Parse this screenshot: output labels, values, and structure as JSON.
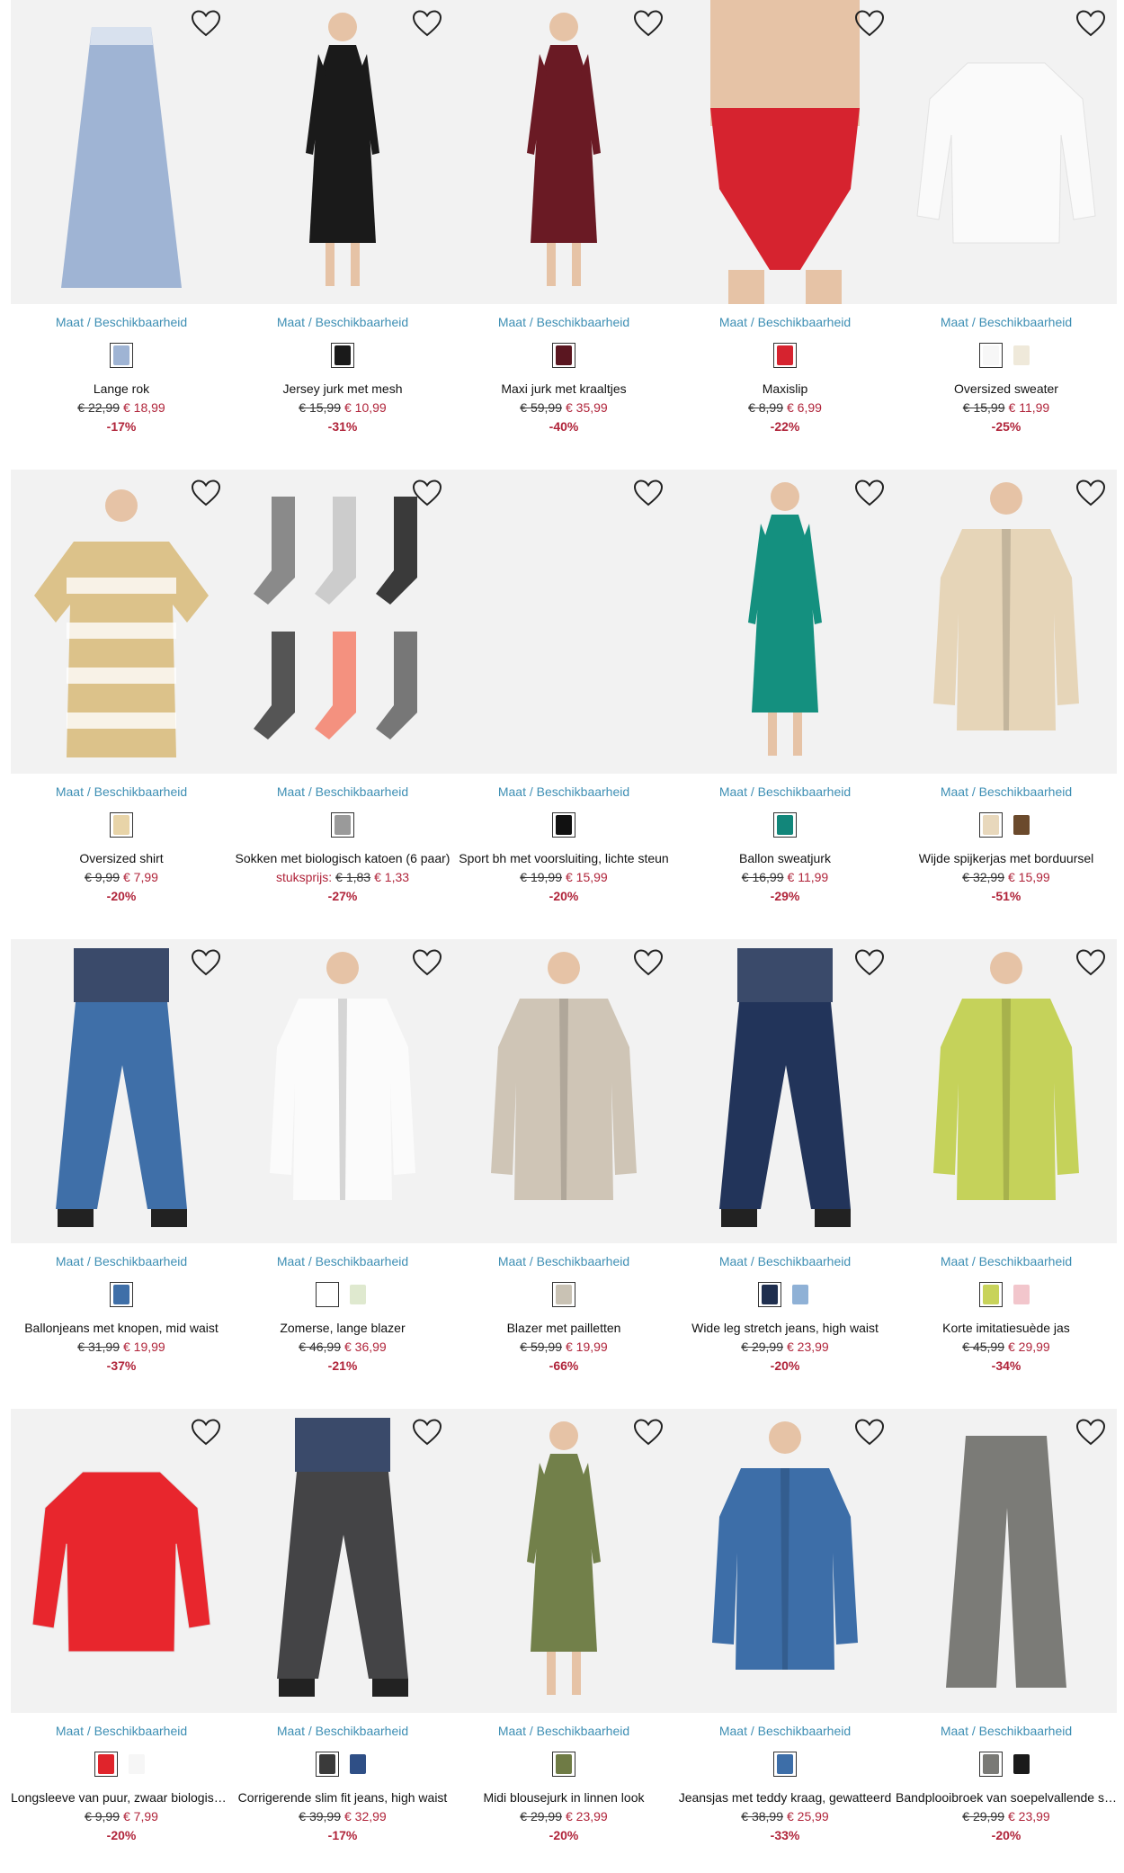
{
  "colors": {
    "link": "#3e8fb4",
    "sale": "#b0243a",
    "image_bg": "#f2f2f2"
  },
  "products": [
    {
      "name": "Lange rok",
      "old": "€ 22,99",
      "new": "€ 18,99",
      "disc": "-17%",
      "maat": "Maat / Beschikbaarheid",
      "swatches": [
        "#9fb4d4"
      ],
      "garment": "skirt",
      "color": "#9fb4d4",
      "heart_icon": "heart-outline-icon"
    },
    {
      "name": "Jersey jurk met mesh",
      "old": "€ 15,99",
      "new": "€ 10,99",
      "disc": "-31%",
      "maat": "Maat / Beschikbaarheid",
      "swatches": [
        "#1a1a1a"
      ],
      "garment": "dress",
      "color": "#1a1a1a",
      "heart_icon": "heart-outline-icon"
    },
    {
      "name": "Maxi jurk met kraaltjes",
      "old": "€ 59,99",
      "new": "€ 35,99",
      "disc": "-40%",
      "maat": "Maat / Beschikbaarheid",
      "swatches": [
        "#5a1620"
      ],
      "garment": "dress",
      "color": "#6a1a24",
      "heart_icon": "heart-outline-icon"
    },
    {
      "name": "Maxislip",
      "old": "€ 8,99",
      "new": "€ 6,99",
      "disc": "-22%",
      "maat": "Maat / Beschikbaarheid",
      "swatches": [
        "#d6232f"
      ],
      "garment": "brief",
      "color": "#d6232f",
      "heart_icon": "heart-outline-icon"
    },
    {
      "name": "Oversized sweater",
      "old": "€ 15,99",
      "new": "€ 11,99",
      "disc": "-25%",
      "maat": "Maat / Beschikbaarheid",
      "swatches": [
        "#f7f7f7",
        "#efe9da"
      ],
      "garment": "top",
      "color": "#fafafa",
      "heart_icon": "heart-outline-icon"
    },
    {
      "name": "Oversized shirt",
      "old": "€ 9,99",
      "new": "€ 7,99",
      "disc": "-20%",
      "maat": "Maat / Beschikbaarheid",
      "swatches": [
        "#e8d4a8"
      ],
      "garment": "tee",
      "color": "#dcc28a",
      "heart_icon": "heart-outline-icon"
    },
    {
      "name": "Sokken met biologisch katoen (6 paar)",
      "unit": "stuksprijs:",
      "old": "€ 1,83",
      "new": "€ 1,33",
      "disc": "-27%",
      "maat": "Maat / Beschikbaarheid",
      "swatches": [
        "#9a9a9a"
      ],
      "garment": "socks",
      "color": "#888888",
      "heart_icon": "heart-outline-icon"
    },
    {
      "name": "Sport bh met voorsluiting, lichte steun",
      "old": "€ 19,99",
      "new": "€ 15,99",
      "disc": "-20%",
      "maat": "Maat / Beschikbaarheid",
      "swatches": [
        "#111111"
      ],
      "garment": "none",
      "color": "#f2f2f2",
      "heart_icon": "heart-outline-icon"
    },
    {
      "name": "Ballon sweatjurk",
      "old": "€ 16,99",
      "new": "€ 11,99",
      "disc": "-29%",
      "maat": "Maat / Beschikbaarheid",
      "swatches": [
        "#12867a"
      ],
      "garment": "dress",
      "color": "#14907f",
      "heart_icon": "heart-outline-icon"
    },
    {
      "name": "Wijde spijkerjas met borduursel",
      "old": "€ 32,99",
      "new": "€ 15,99",
      "disc": "-51%",
      "maat": "Maat / Beschikbaarheid",
      "swatches": [
        "#e8d8bc",
        "#6b4a2c"
      ],
      "garment": "jacket",
      "color": "#e6d5b8",
      "heart_icon": "heart-outline-icon"
    },
    {
      "name": "Ballonjeans met knopen, mid waist",
      "old": "€ 31,99",
      "new": "€ 19,99",
      "disc": "-37%",
      "maat": "Maat / Beschikbaarheid",
      "swatches": [
        "#3f6fa8"
      ],
      "garment": "jeans",
      "color": "#3f6fa8",
      "heart_icon": "heart-outline-icon"
    },
    {
      "name": "Zomerse, lange blazer",
      "old": "€ 46,99",
      "new": "€ 36,99",
      "disc": "-21%",
      "maat": "Maat / Beschikbaarheid",
      "swatches": [
        "#ffffff",
        "#dfe9cf"
      ],
      "garment": "jacket",
      "color": "#fbfbfb",
      "heart_icon": "heart-outline-icon"
    },
    {
      "name": "Blazer met pailletten",
      "old": "€ 59,99",
      "new": "€ 19,99",
      "disc": "-66%",
      "maat": "Maat / Beschikbaarheid",
      "swatches": [
        "#c9c2b4"
      ],
      "garment": "jacket",
      "color": "#cfc5b6",
      "heart_icon": "heart-outline-icon"
    },
    {
      "name": "Wide leg stretch jeans, high waist",
      "old": "€ 29,99",
      "new": "€ 23,99",
      "disc": "-20%",
      "maat": "Maat / Beschikbaarheid",
      "swatches": [
        "#1f2f4f",
        "#8fb1d6"
      ],
      "garment": "jeans",
      "color": "#22345a",
      "heart_icon": "heart-outline-icon"
    },
    {
      "name": "Korte imitatiesuède jas",
      "old": "€ 45,99",
      "new": "€ 29,99",
      "disc": "-34%",
      "maat": "Maat / Beschikbaarheid",
      "swatches": [
        "#c8d35a",
        "#f2c6cc"
      ],
      "garment": "jacket",
      "color": "#c5d25a",
      "heart_icon": "heart-outline-icon"
    },
    {
      "name": "Longsleeve van puur, zwaar biologisch katoen",
      "old": "€ 9,99",
      "new": "€ 7,99",
      "disc": "-20%",
      "maat": "Maat / Beschikbaarheid",
      "swatches": [
        "#e0242b",
        "#f6f6f6"
      ],
      "garment": "top",
      "color": "#e8262d",
      "heart_icon": "heart-outline-icon"
    },
    {
      "name": "Corrigerende slim fit jeans, high waist",
      "old": "€ 39,99",
      "new": "€ 32,99",
      "disc": "-17%",
      "maat": "Maat / Beschikbaarheid",
      "swatches": [
        "#3a3a3a",
        "#2f4f86"
      ],
      "garment": "jeans",
      "color": "#444446",
      "heart_icon": "heart-outline-icon"
    },
    {
      "name": "Midi blousejurk in linnen look",
      "old": "€ 29,99",
      "new": "€ 23,99",
      "disc": "-20%",
      "maat": "Maat / Beschikbaarheid",
      "swatches": [
        "#6f7b45"
      ],
      "garment": "dress",
      "color": "#72804a",
      "heart_icon": "heart-outline-icon"
    },
    {
      "name": "Jeansjas met teddy kraag, gewatteerd",
      "old": "€ 38,99",
      "new": "€ 25,99",
      "disc": "-33%",
      "maat": "Maat / Beschikbaarheid",
      "swatches": [
        "#3d6ea8"
      ],
      "garment": "jacket",
      "color": "#3d6ea8",
      "heart_icon": "heart-outline-icon"
    },
    {
      "name": "Bandplooibroek van soepelvallende stof",
      "old": "€ 29,99",
      "new": "€ 23,99",
      "disc": "-20%",
      "maat": "Maat / Beschikbaarheid",
      "swatches": [
        "#7a7a76",
        "#1a1a1a"
      ],
      "garment": "trousers",
      "color": "#7b7b77",
      "heart_icon": "heart-outline-icon"
    }
  ]
}
